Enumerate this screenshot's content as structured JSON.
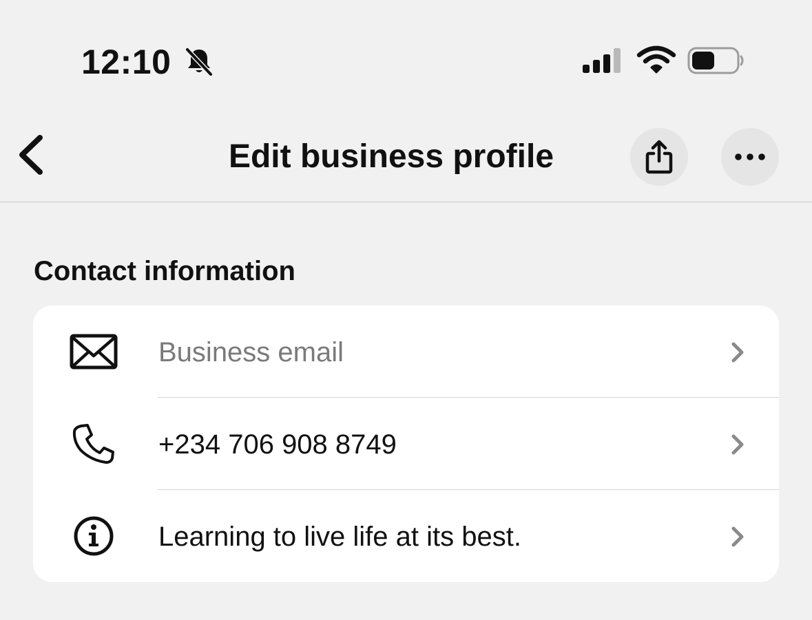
{
  "status_bar": {
    "time": "12:10",
    "icons": [
      "bell-off-icon",
      "cellular-signal-icon",
      "wifi-icon",
      "battery-icon"
    ]
  },
  "nav": {
    "title": "Edit business profile",
    "back_icon": "chevron-left-icon",
    "share_icon": "share-icon",
    "more_icon": "more-horizontal-icon"
  },
  "contact": {
    "section_title": "Contact information",
    "rows": [
      {
        "icon": "envelope-icon",
        "text": "Business email",
        "is_placeholder": true
      },
      {
        "icon": "phone-icon",
        "text": "+234 706 908 8749",
        "is_placeholder": false
      },
      {
        "icon": "info-icon",
        "text": "Learning to live life at its best.",
        "is_placeholder": false
      }
    ]
  },
  "colors": {
    "background": "#f2f1f1",
    "card": "#ffffff",
    "text": "#111111",
    "placeholder": "#7a7a7a",
    "chevron": "#8a8a8a",
    "button_bg": "#e6e5e5"
  }
}
